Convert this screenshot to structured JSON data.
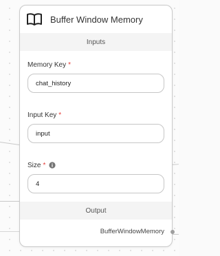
{
  "node": {
    "title": "Buffer Window Memory",
    "icon": "book-icon",
    "inputs_label": "Inputs",
    "output_label": "Output",
    "fields": {
      "memory_key": {
        "label": "Memory Key",
        "required": "*",
        "value": "chat_history"
      },
      "input_key": {
        "label": "Input Key",
        "required": "*",
        "value": "input"
      },
      "size": {
        "label": "Size",
        "required": "*",
        "value": "4",
        "info_icon": "info-icon"
      }
    },
    "output": {
      "value": "BufferWindowMemory"
    }
  },
  "colors": {
    "required": "#e53935",
    "border": "#c6c6c6",
    "band": "#f4f4f4"
  }
}
